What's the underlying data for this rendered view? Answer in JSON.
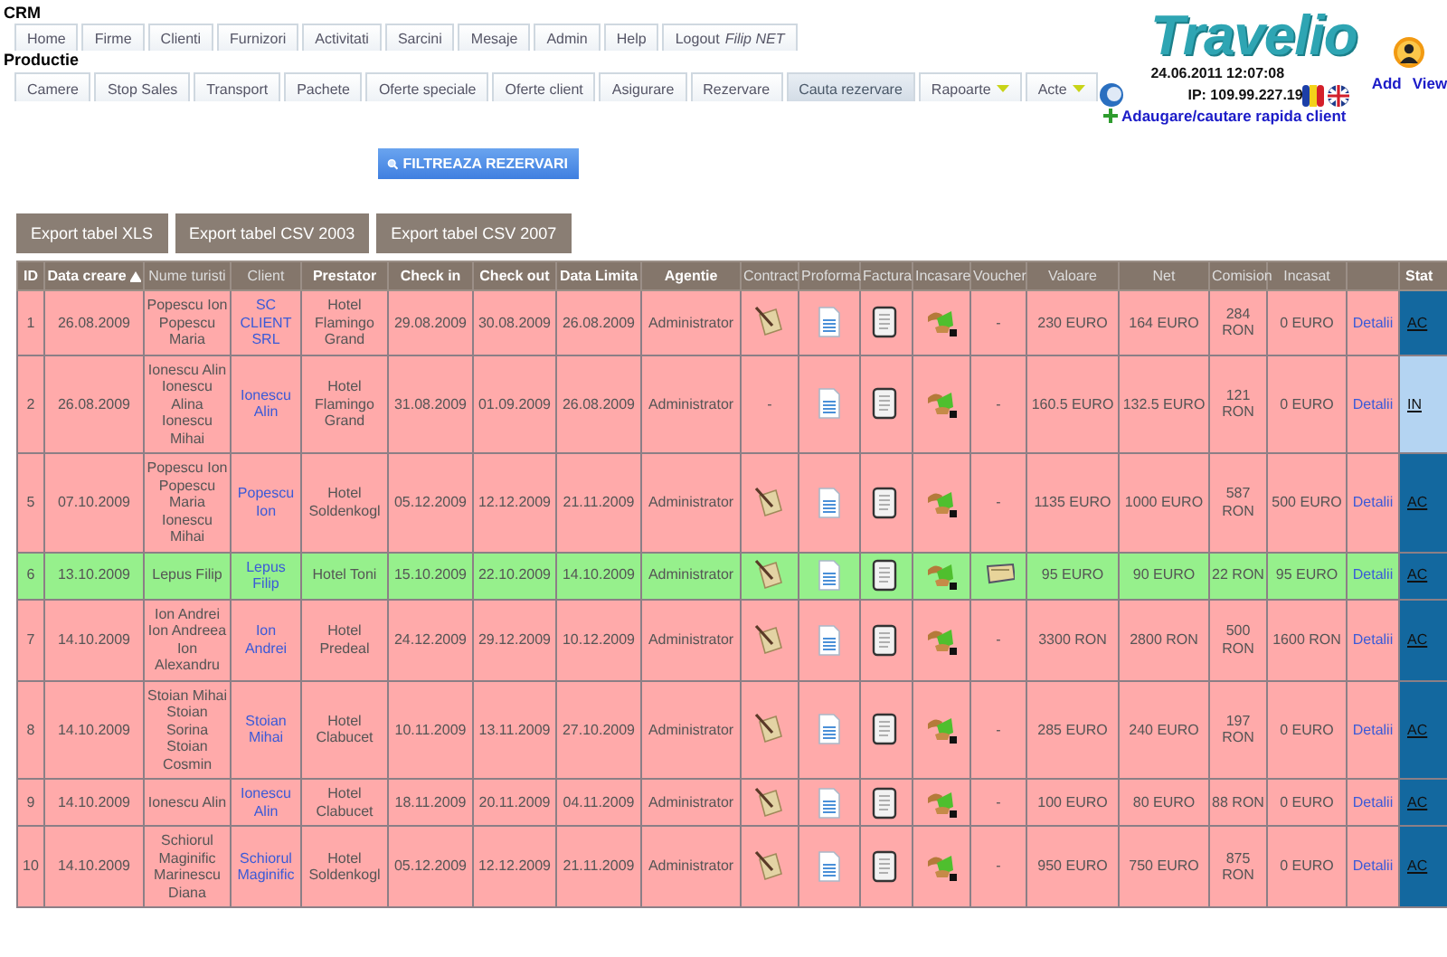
{
  "app": {
    "title": "CRM",
    "section": "Productie"
  },
  "main_tabs": [
    {
      "label": "Home",
      "selected": false
    },
    {
      "label": "Firme",
      "selected": false
    },
    {
      "label": "Clienti",
      "selected": false
    },
    {
      "label": "Furnizori",
      "selected": false
    },
    {
      "label": "Activitati",
      "selected": false
    },
    {
      "label": "Sarcini",
      "selected": false
    },
    {
      "label": "Mesaje",
      "selected": false
    },
    {
      "label": "Admin",
      "selected": false
    },
    {
      "label": "Help",
      "selected": false
    },
    {
      "label": "Logout *Filip NET*",
      "selected": false
    }
  ],
  "section_tabs": [
    {
      "label": "Camere",
      "selected": false,
      "dropdown": false
    },
    {
      "label": "Stop Sales",
      "selected": false,
      "dropdown": false
    },
    {
      "label": "Transport",
      "selected": false,
      "dropdown": false
    },
    {
      "label": "Pachete",
      "selected": false,
      "dropdown": false
    },
    {
      "label": "Oferte speciale",
      "selected": false,
      "dropdown": false
    },
    {
      "label": "Oferte client",
      "selected": false,
      "dropdown": false
    },
    {
      "label": "Asigurare",
      "selected": false,
      "dropdown": false
    },
    {
      "label": "Rezervare",
      "selected": false,
      "dropdown": false
    },
    {
      "label": "Cauta rezervare",
      "selected": true,
      "dropdown": false
    },
    {
      "label": "Rapoarte",
      "selected": false,
      "dropdown": true
    },
    {
      "label": "Acte",
      "selected": false,
      "dropdown": true
    }
  ],
  "header_right": {
    "logo": "Travelio",
    "datetime": "24.06.2011 12:07:08",
    "ip": "IP: 109.99.227.19",
    "quick_client_link": "Adaugare/cautare rapida client",
    "user_links": [
      "Add",
      "View"
    ]
  },
  "filter_button": "FILTREAZA REZERVARI",
  "export_buttons": [
    "Export tabel XLS",
    "Export tabel CSV 2003",
    "Export tabel CSV 2007"
  ],
  "table": {
    "columns": [
      {
        "label": "ID",
        "sortable": true,
        "sorted": false
      },
      {
        "label": "Data creare",
        "sortable": true,
        "sorted": true
      },
      {
        "label": "Nume turisti",
        "sortable": false,
        "sorted": false
      },
      {
        "label": "Client",
        "sortable": false,
        "sorted": false
      },
      {
        "label": "Prestator",
        "sortable": true,
        "sorted": false
      },
      {
        "label": "Check in",
        "sortable": true,
        "sorted": false
      },
      {
        "label": "Check out",
        "sortable": true,
        "sorted": false
      },
      {
        "label": "Data Limita",
        "sortable": true,
        "sorted": false
      },
      {
        "label": "Agentie",
        "sortable": true,
        "sorted": false
      },
      {
        "label": "Contract",
        "sortable": false,
        "sorted": false
      },
      {
        "label": "Proforma",
        "sortable": false,
        "sorted": false
      },
      {
        "label": "Factura",
        "sortable": false,
        "sorted": false
      },
      {
        "label": "Incasare",
        "sortable": false,
        "sorted": false
      },
      {
        "label": "Voucher",
        "sortable": false,
        "sorted": false
      },
      {
        "label": "Valoare",
        "sortable": false,
        "sorted": false
      },
      {
        "label": "Net",
        "sortable": false,
        "sorted": false
      },
      {
        "label": "Comision",
        "sortable": false,
        "sorted": false
      },
      {
        "label": "Incasat",
        "sortable": false,
        "sorted": false
      },
      {
        "sortable": false
      },
      {
        "label": "Stat",
        "sortable": true,
        "sorted": false
      }
    ],
    "rows": [
      {
        "color": "#ffaaaa",
        "id": "1",
        "created": "26.08.2009",
        "tourists": "Popescu Ion Popescu Maria",
        "client": "SC CLIENT SRL",
        "provider": "Hotel Flamingo Grand",
        "check_in": "29.08.2009",
        "check_out": "30.08.2009",
        "deadline": "26.08.2009",
        "agency": "Administrator",
        "contract": {
          "kind": "icon"
        },
        "proforma": {
          "kind": "icon"
        },
        "invoice": {
          "kind": "icon"
        },
        "payment": {
          "kind": "icon"
        },
        "voucher": {
          "kind": "text",
          "text": "-"
        },
        "value": "230 EURO",
        "net": "164 EURO",
        "commission": "284 RON",
        "collected": "0 EURO",
        "details": "Detalii",
        "status": {
          "text": "AC",
          "color": "#13689f"
        }
      },
      {
        "color": "#ffaaaa",
        "id": "2",
        "created": "26.08.2009",
        "tourists": "Ionescu Alin Ionescu Alina Ionescu Mihai",
        "client": "Ionescu Alin",
        "provider": "Hotel Flamingo Grand",
        "check_in": "31.08.2009",
        "check_out": "01.09.2009",
        "deadline": "26.08.2009",
        "agency": "Administrator",
        "contract": {
          "kind": "text",
          "text": "-"
        },
        "proforma": {
          "kind": "icon"
        },
        "invoice": {
          "kind": "icon"
        },
        "payment": {
          "kind": "icon"
        },
        "voucher": {
          "kind": "text",
          "text": "-"
        },
        "value": "160.5 EURO",
        "net": "132.5 EURO",
        "commission": "121 RON",
        "collected": "0 EURO",
        "details": "Detalii",
        "status": {
          "text": "IN",
          "color": "#b4d4f2"
        }
      },
      {
        "color": "#ffaaaa",
        "id": "5",
        "created": "07.10.2009",
        "tourists": "Popescu Ion Popescu Maria Ionescu Mihai",
        "client": "Popescu Ion",
        "provider": "Hotel Soldenkogl",
        "check_in": "05.12.2009",
        "check_out": "12.12.2009",
        "deadline": "21.11.2009",
        "agency": "Administrator",
        "contract": {
          "kind": "icon"
        },
        "proforma": {
          "kind": "icon"
        },
        "invoice": {
          "kind": "icon"
        },
        "payment": {
          "kind": "icon"
        },
        "voucher": {
          "kind": "text",
          "text": "-"
        },
        "value": "1135 EURO",
        "net": "1000 EURO",
        "commission": "587 RON",
        "collected": "500 EURO",
        "details": "Detalii",
        "status": {
          "text": "AC",
          "color": "#13689f"
        }
      },
      {
        "color": "#96f08c",
        "id": "6",
        "created": "13.10.2009",
        "tourists": "Lepus Filip",
        "client": "Lepus Filip",
        "provider": "Hotel Toni",
        "check_in": "15.10.2009",
        "check_out": "22.10.2009",
        "deadline": "14.10.2009",
        "agency": "Administrator",
        "contract": {
          "kind": "icon"
        },
        "proforma": {
          "kind": "icon"
        },
        "invoice": {
          "kind": "icon"
        },
        "payment": {
          "kind": "icon"
        },
        "voucher": {
          "kind": "icon"
        },
        "value": "95 EURO",
        "net": "90 EURO",
        "commission": "22 RON",
        "collected": "95 EURO",
        "details": "Detalii",
        "status": {
          "text": "AC",
          "color": "#13689f"
        }
      },
      {
        "color": "#ffaaaa",
        "id": "7",
        "created": "14.10.2009",
        "tourists": "Ion Andrei Ion Andreea Ion Alexandru",
        "client": "Ion Andrei",
        "provider": "Hotel Predeal",
        "check_in": "24.12.2009",
        "check_out": "29.12.2009",
        "deadline": "10.12.2009",
        "agency": "Administrator",
        "contract": {
          "kind": "icon"
        },
        "proforma": {
          "kind": "icon"
        },
        "invoice": {
          "kind": "icon"
        },
        "payment": {
          "kind": "icon"
        },
        "voucher": {
          "kind": "text",
          "text": "-"
        },
        "value": "3300 RON",
        "net": "2800 RON",
        "commission": "500 RON",
        "collected": "1600 RON",
        "details": "Detalii",
        "status": {
          "text": "AC",
          "color": "#13689f"
        }
      },
      {
        "color": "#ffaaaa",
        "id": "8",
        "created": "14.10.2009",
        "tourists": "Stoian Mihai Stoian Sorina Stoian Cosmin",
        "client": "Stoian Mihai",
        "provider": "Hotel Clabucet",
        "check_in": "10.11.2009",
        "check_out": "13.11.2009",
        "deadline": "27.10.2009",
        "agency": "Administrator",
        "contract": {
          "kind": "icon"
        },
        "proforma": {
          "kind": "icon"
        },
        "invoice": {
          "kind": "icon"
        },
        "payment": {
          "kind": "icon"
        },
        "voucher": {
          "kind": "text",
          "text": "-"
        },
        "value": "285 EURO",
        "net": "240 EURO",
        "commission": "197 RON",
        "collected": "0 EURO",
        "details": "Detalii",
        "status": {
          "text": "AC",
          "color": "#13689f"
        }
      },
      {
        "color": "#ffaaaa",
        "id": "9",
        "created": "14.10.2009",
        "tourists": "Ionescu Alin",
        "client": "Ionescu Alin",
        "provider": "Hotel Clabucet",
        "check_in": "18.11.2009",
        "check_out": "20.11.2009",
        "deadline": "04.11.2009",
        "agency": "Administrator",
        "contract": {
          "kind": "icon"
        },
        "proforma": {
          "kind": "icon"
        },
        "invoice": {
          "kind": "icon"
        },
        "payment": {
          "kind": "icon"
        },
        "voucher": {
          "kind": "text",
          "text": "-"
        },
        "value": "100 EURO",
        "net": "80 EURO",
        "commission": "88 RON",
        "collected": "0 EURO",
        "details": "Detalii",
        "status": {
          "text": "AC",
          "color": "#13689f"
        }
      },
      {
        "color": "#ffaaaa",
        "id": "10",
        "created": "14.10.2009",
        "tourists": "Schiorul Maginific Marinescu Diana",
        "client": "Schiorul Maginific",
        "provider": "Hotel Soldenkogl",
        "check_in": "05.12.2009",
        "check_out": "12.12.2009",
        "deadline": "21.11.2009",
        "agency": "Administrator",
        "contract": {
          "kind": "icon"
        },
        "proforma": {
          "kind": "icon"
        },
        "invoice": {
          "kind": "icon"
        },
        "payment": {
          "kind": "icon"
        },
        "voucher": {
          "kind": "text",
          "text": "-"
        },
        "value": "950 EURO",
        "net": "750 EURO",
        "commission": "875 RON",
        "collected": "0 EURO",
        "details": "Detalii",
        "status": {
          "text": "AC",
          "color": "#13689f"
        }
      }
    ]
  }
}
